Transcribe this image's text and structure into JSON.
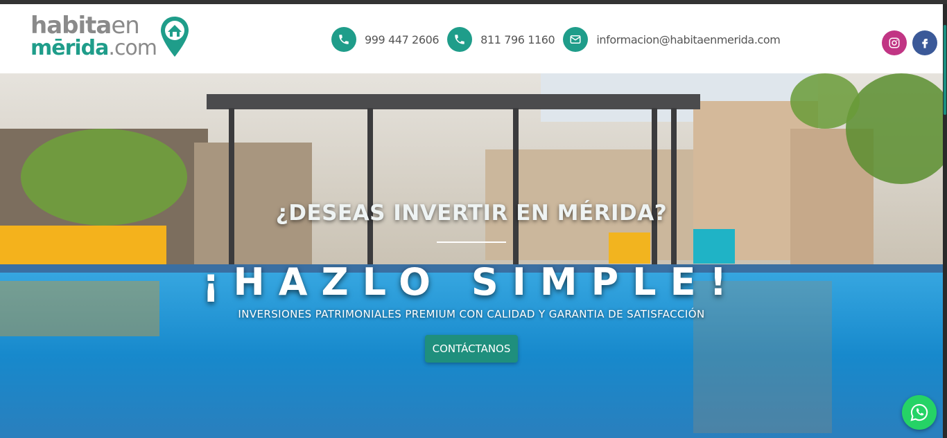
{
  "logo": {
    "line1_main": "habita",
    "line1_en": "en",
    "line2_main": "mērida",
    "line2_com": ".com"
  },
  "contacts": [
    {
      "icon": "phone-icon",
      "text": "999 447 2606"
    },
    {
      "icon": "phone-icon",
      "text": "811 796 1160"
    },
    {
      "icon": "email-icon",
      "text": "informacion@habitaenmerida.com"
    }
  ],
  "social": [
    {
      "icon": "instagram-icon",
      "color": "#c13584"
    },
    {
      "icon": "facebook-icon",
      "color": "#3b5998"
    }
  ],
  "hero": {
    "question": "¿DESEAS INVERTIR EN MÉRIDA?",
    "headline": "¡HAZLO SIMPLE!",
    "subtitle": "INVERSIONES PATRIMONIALES PREMIUM CON CALIDAD Y GARANTIA DE SATISFACCIÓN",
    "cta_label": "CONTÁCTANOS"
  },
  "colors": {
    "accent": "#1f9d8a",
    "cta": "#1f8f7d",
    "whatsapp": "#25d366"
  },
  "whatsapp": {
    "icon": "whatsapp-icon"
  }
}
